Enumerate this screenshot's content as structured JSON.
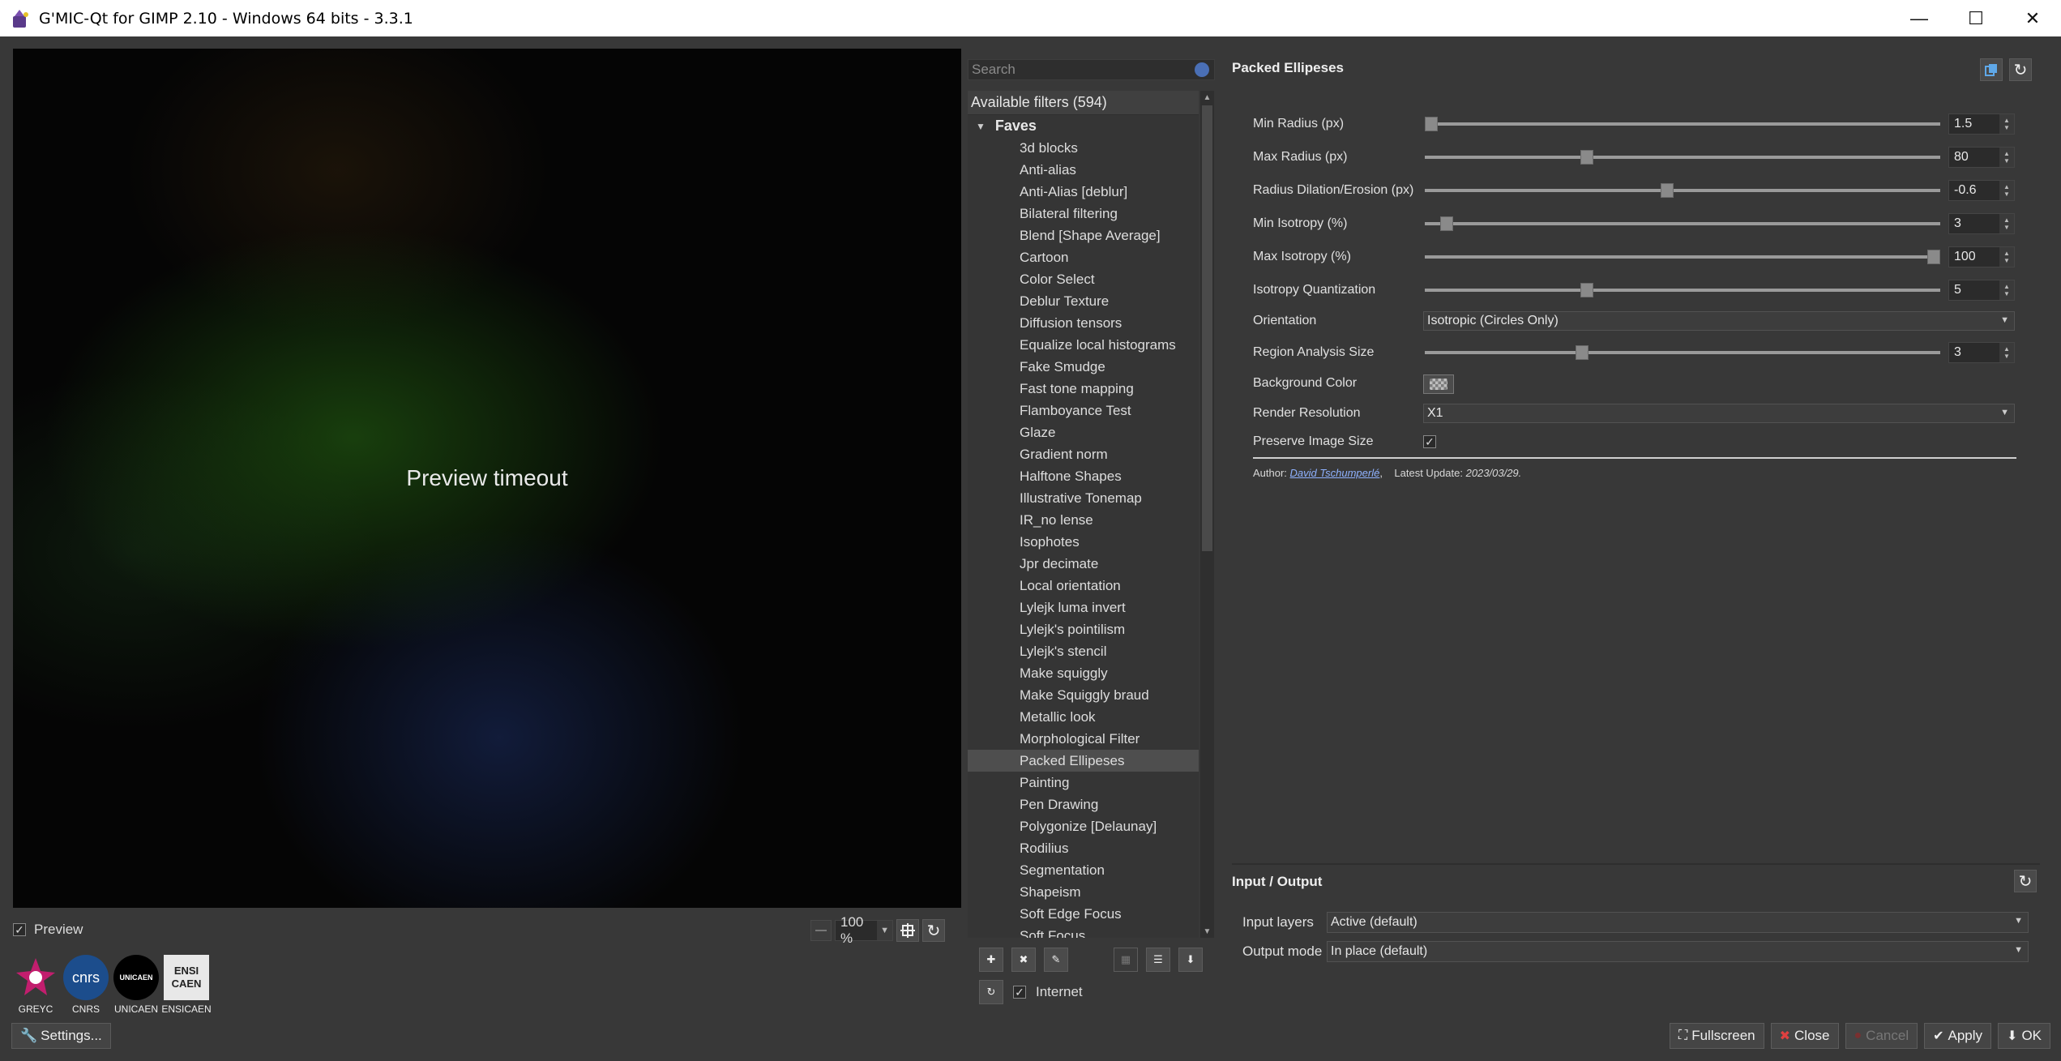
{
  "window": {
    "title": "G'MIC-Qt for GIMP 2.10 - Windows 64 bits - 3.3.1",
    "minimize": "—",
    "maximize": "☐",
    "close": "✕"
  },
  "preview": {
    "message": "Preview timeout",
    "checkbox_label": "Preview",
    "checked": "✓",
    "zoom_value": "100 %"
  },
  "logos": [
    {
      "name": "GREYC",
      "color": "#c21e6e"
    },
    {
      "name": "CNRS",
      "color": "#1c4d8c"
    },
    {
      "name": "UNICAEN",
      "color": "#000000"
    },
    {
      "name": "ENSICAEN",
      "color": "#d8d8d8"
    }
  ],
  "logo_marks": {
    "cnrs": "cnrs",
    "unicaen": "UNICAEN",
    "ensicaen": "ENSI CAEN"
  },
  "settings_label": "Settings...",
  "search": {
    "placeholder": "Search"
  },
  "filters": {
    "header": "Available filters (594)",
    "folder": "Faves",
    "items": [
      "3d blocks",
      "Anti-alias",
      "Anti-Alias [deblur]",
      "Bilateral filtering",
      "Blend [Shape Average]",
      "Cartoon",
      "Color Select",
      "Deblur Texture",
      "Diffusion tensors",
      "Equalize local histograms",
      "Fake Smudge",
      "Fast tone mapping",
      "Flamboyance Test",
      "Glaze",
      "Gradient norm",
      "Halftone Shapes",
      "Illustrative Tonemap",
      "IR_no lense",
      "Isophotes",
      "Jpr decimate",
      "Local orientation",
      "Lylejk luma invert",
      "Lylejk's pointilism",
      "Lylejk's stencil",
      "Make squiggly",
      "Make Squiggly braud",
      "Metallic look",
      "Morphological Filter",
      "Packed Ellipeses",
      "Painting",
      "Pen Drawing",
      "Polygonize [Delaunay]",
      "Rodilius",
      "Segmentation",
      "Shapeism",
      "Soft Edge Focus",
      "Soft Focus"
    ],
    "selected": "Packed Ellipeses"
  },
  "internet_label": "Internet",
  "params": {
    "title": "Packed Ellipeses",
    "min_radius": {
      "label": "Min Radius (px)",
      "value": "1.5",
      "level": 0.0
    },
    "max_radius": {
      "label": "Max Radius (px)",
      "value": "80",
      "level": 0.31
    },
    "radius_dilation": {
      "label": "Radius Dilation/Erosion (px)",
      "value": "-0.6",
      "level": 0.47
    },
    "min_isotropy": {
      "label": "Min Isotropy (%)",
      "value": "3",
      "level": 0.03
    },
    "max_isotropy": {
      "label": "Max Isotropy (%)",
      "value": "100",
      "level": 1.0
    },
    "isotropy_quant": {
      "label": "Isotropy Quantization",
      "value": "5",
      "level": 0.31
    },
    "orientation": {
      "label": "Orientation",
      "value": "Isotropic (Circles Only)"
    },
    "region_size": {
      "label": "Region Analysis Size",
      "value": "3",
      "level": 0.3
    },
    "background_color": {
      "label": "Background Color"
    },
    "render_resolution": {
      "label": "Render Resolution",
      "value": "X1"
    },
    "preserve_size": {
      "label": "Preserve Image Size",
      "checked": "✓"
    },
    "author_prefix": "Author:",
    "author": "David Tschumperlé",
    "update_prefix": "Latest Update:",
    "update_date": "2023/03/29."
  },
  "io": {
    "title": "Input / Output",
    "input_label": "Input layers",
    "input_value": "Active (default)",
    "output_label": "Output mode",
    "output_value": "In place (default)"
  },
  "buttons": {
    "fullscreen": "Fullscreen",
    "close": "Close",
    "cancel": "Cancel",
    "apply": "Apply",
    "ok": "OK"
  }
}
